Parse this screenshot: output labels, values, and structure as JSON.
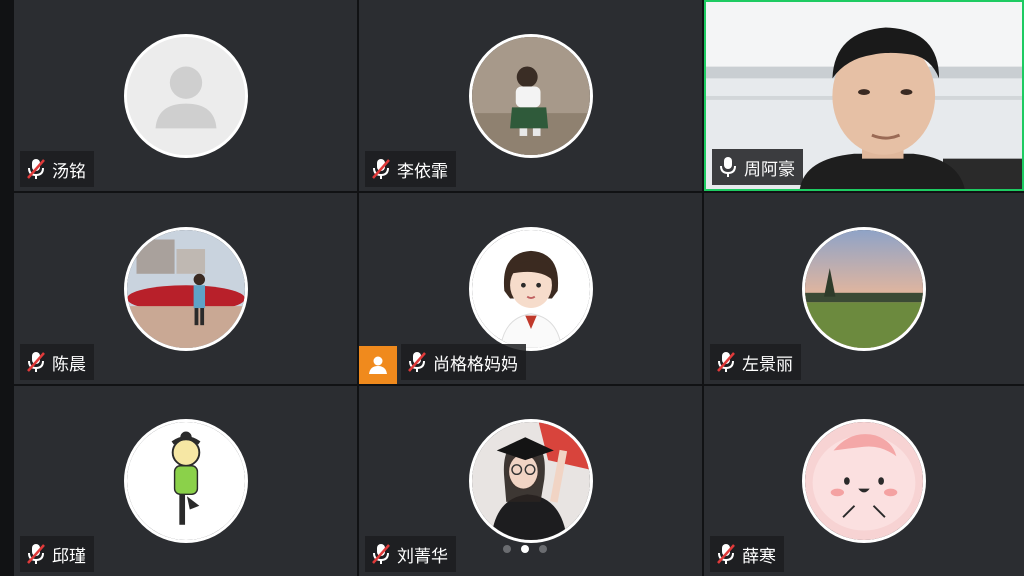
{
  "participants": [
    {
      "name": "汤铭",
      "mic": "muted"
    },
    {
      "name": "李依霏",
      "mic": "muted"
    },
    {
      "name": "周阿豪",
      "mic": "on"
    },
    {
      "name": "陈晨",
      "mic": "muted"
    },
    {
      "name": "尚格格妈妈",
      "mic": "muted",
      "host": true
    },
    {
      "name": "左景丽",
      "mic": "muted"
    },
    {
      "name": "邱瑾",
      "mic": "muted"
    },
    {
      "name": "刘菁华",
      "mic": "muted"
    },
    {
      "name": "薛寒",
      "mic": "muted"
    }
  ],
  "pagination": {
    "total": 3,
    "current": 2
  },
  "colors": {
    "tile_bg": "#2b2d31",
    "active_speaker_border": "#1ecb62",
    "muted_icon": "#e03a3a",
    "host_badge": "#f08a1d"
  },
  "icons": {
    "muted_mic": "mic-off-icon",
    "active_mic": "mic-icon",
    "host": "host-person-icon",
    "default_avatar": "person-silhouette-icon"
  }
}
